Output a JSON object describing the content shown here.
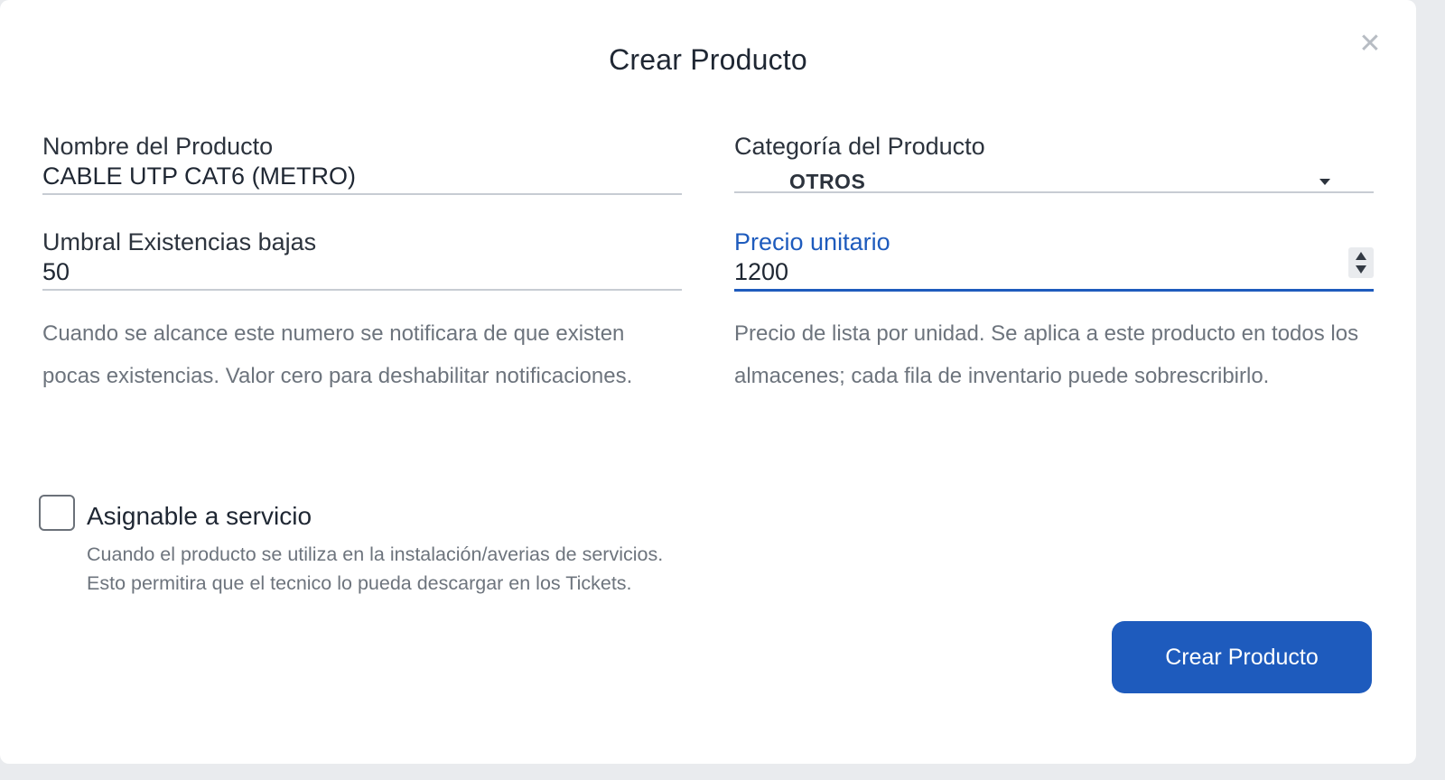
{
  "dialog": {
    "title": "Crear Producto",
    "close_symbol": "✕"
  },
  "fields": {
    "nombre": {
      "label": "Nombre del Producto",
      "value": "CABLE UTP CAT6 (METRO)"
    },
    "categoria": {
      "label": "Categoría del Producto",
      "selected": "OTROS"
    },
    "umbral": {
      "label": "Umbral Existencias bajas",
      "value": "50",
      "help": "Cuando se alcance este numero se notificara de que existen pocas existencias. Valor cero para deshabilitar notificaciones."
    },
    "precio": {
      "label": "Precio unitario",
      "value": "1200",
      "help": "Precio de lista por unidad. Se aplica a este producto en todos los almacenes; cada fila de inventario puede sobrescribirlo."
    }
  },
  "asignable": {
    "label": "Asignable a servicio",
    "checked": false,
    "help_line1": "Cuando el producto se utiliza en la instalación/averias de servicios.",
    "help_line2": "Esto permitira que el tecnico lo pueda descargar en los Tickets."
  },
  "actions": {
    "submit_label": "Crear Producto"
  },
  "colors": {
    "accent": "#1e5bbd",
    "text": "#1f2733",
    "muted": "#6d747d",
    "line": "#c7ccd3"
  },
  "icons": {
    "close": "close-icon",
    "dropdown": "chevron-down-icon",
    "stepper_up": "arrow-up-icon",
    "stepper_down": "arrow-down-icon"
  }
}
